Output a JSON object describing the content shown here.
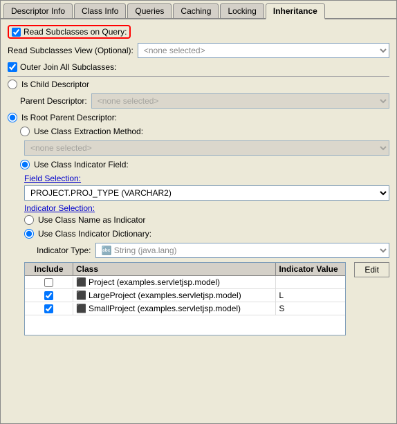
{
  "tabs": [
    {
      "id": "descriptor-info",
      "label": "Descriptor Info",
      "active": false
    },
    {
      "id": "class-info",
      "label": "Class Info",
      "active": false
    },
    {
      "id": "queries",
      "label": "Queries",
      "active": false
    },
    {
      "id": "caching",
      "label": "Caching",
      "active": false
    },
    {
      "id": "locking",
      "label": "Locking",
      "active": false
    },
    {
      "id": "inheritance",
      "label": "Inheritance",
      "active": true
    }
  ],
  "read_subclasses_on_query": {
    "label": "Read Subclasses on Query:",
    "checked": true
  },
  "read_subclasses_view": {
    "label": "Read Subclasses View (Optional):",
    "value": "<none selected>"
  },
  "outer_join": {
    "label": "Outer Join All Subclasses:",
    "checked": true
  },
  "is_child_descriptor": {
    "label": "Is Child Descriptor",
    "checked": false
  },
  "parent_descriptor": {
    "label": "Parent Descriptor:",
    "value": "<none selected>",
    "disabled": true
  },
  "is_root_parent": {
    "label": "Is Root Parent Descriptor:",
    "checked": true
  },
  "use_class_extraction": {
    "label": "Use Class Extraction Method:",
    "checked": false
  },
  "extraction_method_value": "<none selected>",
  "use_class_indicator": {
    "label": "Use Class Indicator Field:",
    "checked": true
  },
  "field_selection": {
    "label": "Field Selection:",
    "value": "PROJECT.PROJ_TYPE (VARCHAR2)"
  },
  "indicator_selection": {
    "label": "Indicator Selection:"
  },
  "use_class_name_indicator": {
    "label": "Use Class Name as Indicator",
    "checked": false
  },
  "use_class_indicator_dict": {
    "label": "Use Class Indicator Dictionary:",
    "checked": true
  },
  "indicator_type": {
    "label": "Indicator Type:",
    "value": "🔤 String (java.lang)"
  },
  "table": {
    "headers": [
      "Include",
      "Class",
      "Indicator Value"
    ],
    "rows": [
      {
        "include": false,
        "class_name": "Project (examples.servletjsp.model)",
        "indicator": ""
      },
      {
        "include": true,
        "class_name": "LargeProject (examples.servletjsp.model)",
        "indicator": "L"
      },
      {
        "include": true,
        "class_name": "SmallProject (examples.servletjsp.model)",
        "indicator": "S"
      }
    ]
  },
  "edit_button": "Edit"
}
